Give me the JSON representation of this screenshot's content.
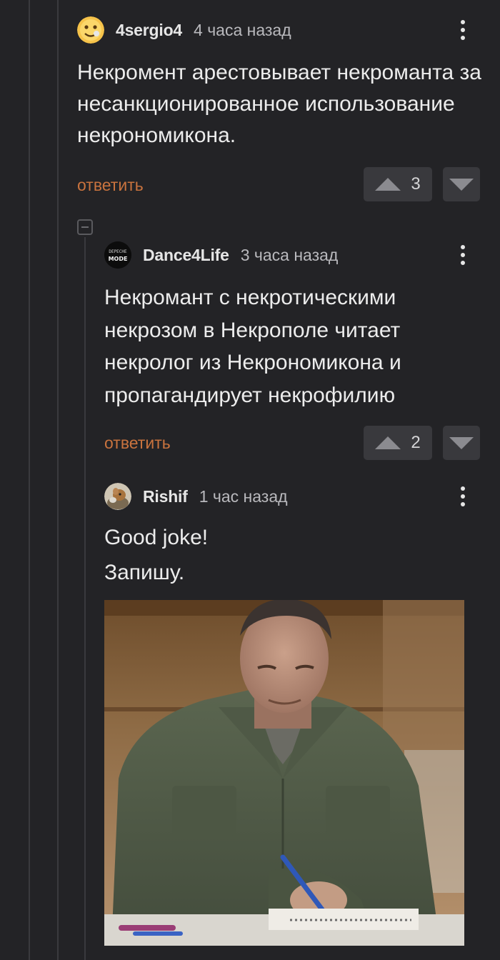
{
  "comments": [
    {
      "username": "4sergio4",
      "time": "4 часа назад",
      "text": "Некромент арестовывает некроманта за несанкционированное использование некрономикона.",
      "reply_label": "ответить",
      "rating": "3"
    },
    {
      "username": "Dance4Life",
      "avatar_text_top": "DEPECHE",
      "avatar_text_bottom": "MODE",
      "time": "3 часа назад",
      "text": "Некромант с некротическими некрозом в Некрополе читает некролог из Некрономикона и пропагандирует некрофилию",
      "reply_label": "ответить",
      "rating": "2"
    },
    {
      "username": "Rishif",
      "time": "1 час назад",
      "text_line1": "Good joke!",
      "text_line2": "Запишу."
    }
  ],
  "colors": {
    "background": "#232326",
    "accent": "#c9733e",
    "vote_button": "#39393d"
  }
}
